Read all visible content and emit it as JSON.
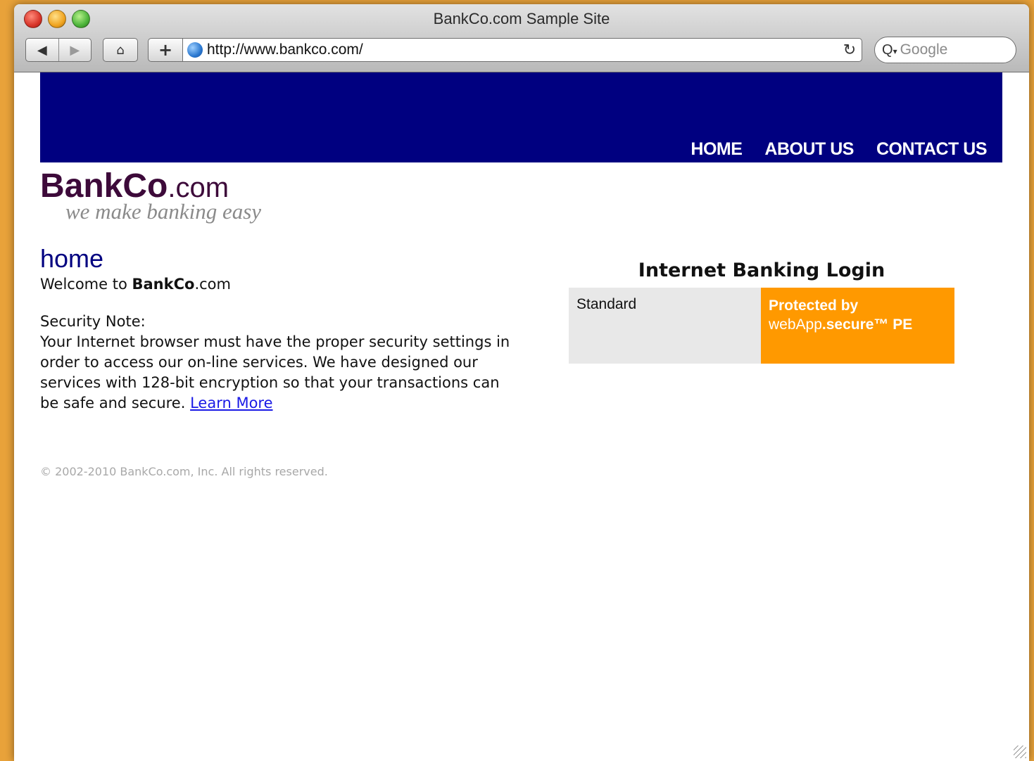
{
  "window": {
    "title": "BankCo.com Sample Site"
  },
  "toolbar": {
    "back_icon": "◀",
    "forward_icon": "▶",
    "home_icon": "⌂",
    "add_icon": "+",
    "reload_icon": "↻",
    "url": "http://www.bankco.com/",
    "search_placeholder": "Google",
    "search_icon": "Q"
  },
  "nav": {
    "items": [
      "HOME",
      "ABOUT US",
      "CONTACT US"
    ]
  },
  "brand": {
    "name_bold": "BankCo",
    "name_suffix": ".com",
    "tagline": "we make banking easy"
  },
  "main": {
    "heading": "home",
    "welcome_prefix": "Welcome to ",
    "welcome_bold": "BankCo",
    "welcome_suffix": ".com",
    "security_title": "Security Note:",
    "security_body": "Your Internet browser must have the proper security settings in order to access our on-line services. We have designed our services with 128-bit encryption so that your transactions can be safe and secure. ",
    "learn_more": "Learn More",
    "copyright": "© 2002-2010 BankCo.com, Inc. All rights reserved."
  },
  "login": {
    "title": "Internet Banking Login",
    "standard_label": "Standard",
    "protected_line1": "Protected by",
    "protected_brand": "webApp",
    "protected_secure": ".secure™ PE"
  },
  "colors": {
    "banner": "#000080",
    "heading": "#000080",
    "protected_bg": "#ff9900",
    "standard_bg": "#e8e8e8",
    "logo": "#3d0a3a"
  }
}
